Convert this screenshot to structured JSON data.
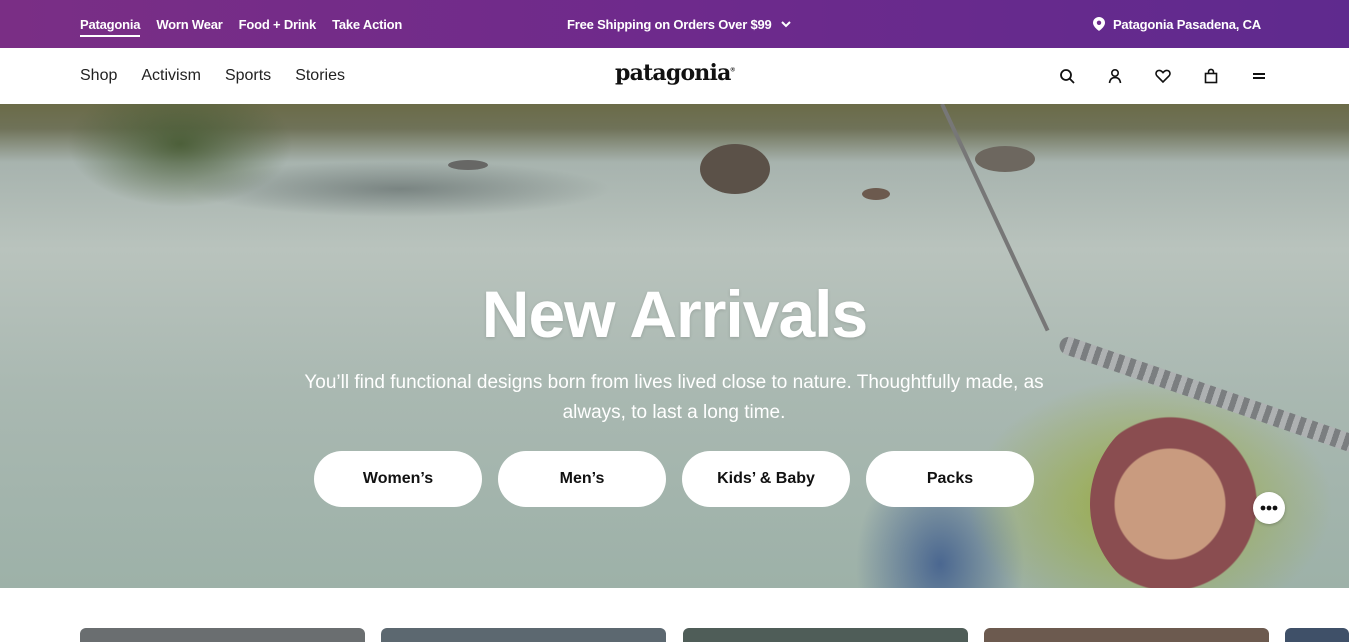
{
  "topbar": {
    "brands": [
      "Patagonia",
      "Worn Wear",
      "Food + Drink",
      "Take Action"
    ],
    "promo": "Free Shipping on Orders Over $99",
    "store": "Patagonia Pasadena, CA"
  },
  "header": {
    "nav": [
      "Shop",
      "Activism",
      "Sports",
      "Stories"
    ],
    "logo": "patagonia",
    "icons": [
      "search-icon",
      "account-icon",
      "heart-icon",
      "bag-icon",
      "menu-icon"
    ]
  },
  "hero": {
    "title": "New Arrivals",
    "subtitle": "You’ll find functional designs born from lives lived close to nature. Thoughtfully made, as always, to last a long time.",
    "buttons": [
      "Women’s",
      "Men’s",
      "Kids’ & Baby",
      "Packs"
    ]
  },
  "colors": {
    "topbar": "#6e2a8c",
    "button_bg": "#ffffff"
  }
}
